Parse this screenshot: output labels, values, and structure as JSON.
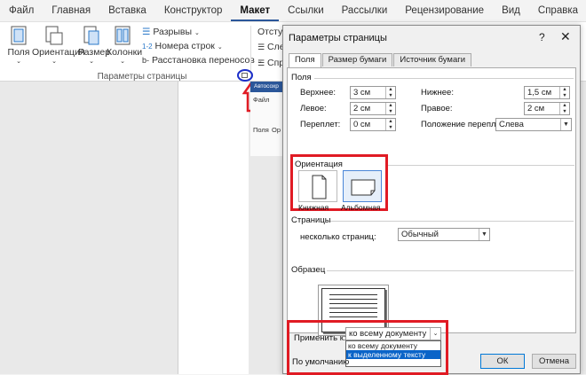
{
  "ribbon": {
    "tabs": [
      "Файл",
      "Главная",
      "Вставка",
      "Конструктор",
      "Макет",
      "Ссылки",
      "Рассылки",
      "Рецензирование",
      "Вид",
      "Справка"
    ],
    "active_tab": "Макет",
    "buttons": {
      "margins": "Поля",
      "orientation": "Ориентация",
      "size": "Размер",
      "columns": "Колонки",
      "breaks": "Разрывы",
      "line_numbers": "Номера строк",
      "hyphenation": "Расстановка переносов"
    },
    "group_label": "Параметры страницы",
    "indent_label": "Отступ",
    "left_label": "Сле",
    "right_label": "Спр"
  },
  "background_window": {
    "title": "Автосохр",
    "file_tab": "Файл",
    "fields": "Поля",
    "orient": "Ор"
  },
  "dialog": {
    "title": "Параметры страницы",
    "help": "?",
    "close": "✕",
    "tabs": [
      "Поля",
      "Размер бумаги",
      "Источник бумаги"
    ],
    "margins_section": "Поля",
    "top_label": "Верхнее:",
    "top_value": "3 см",
    "bottom_label": "Нижнее:",
    "bottom_value": "1,5 см",
    "left_label": "Левое:",
    "left_value": "2 см",
    "right_label": "Правое:",
    "right_value": "2 см",
    "gutter_label": "Переплет:",
    "gutter_value": "0 см",
    "gutter_pos_label": "Положение переплета:",
    "gutter_pos_value": "Слева",
    "orientation_section": "Ориентация",
    "portrait": "Книжная",
    "landscape": "Альбомная",
    "pages_section": "Страницы",
    "multiple_pages_label": "несколько страниц:",
    "multiple_pages_value": "Обычный",
    "preview_section": "Образец",
    "apply_to_label": "Применить к:",
    "apply_to_value": "ко всему документу",
    "apply_options": [
      "ко всему документу",
      "к выделенному тексту"
    ],
    "default_button": "По умолчанию",
    "ok_button": "ОК",
    "cancel_button": "Отмена"
  },
  "colors": {
    "highlight_red": "#e01b24",
    "circle_blue": "#1c2fc9",
    "selection_blue": "#0a64c8",
    "title_blue": "#2b579a"
  }
}
